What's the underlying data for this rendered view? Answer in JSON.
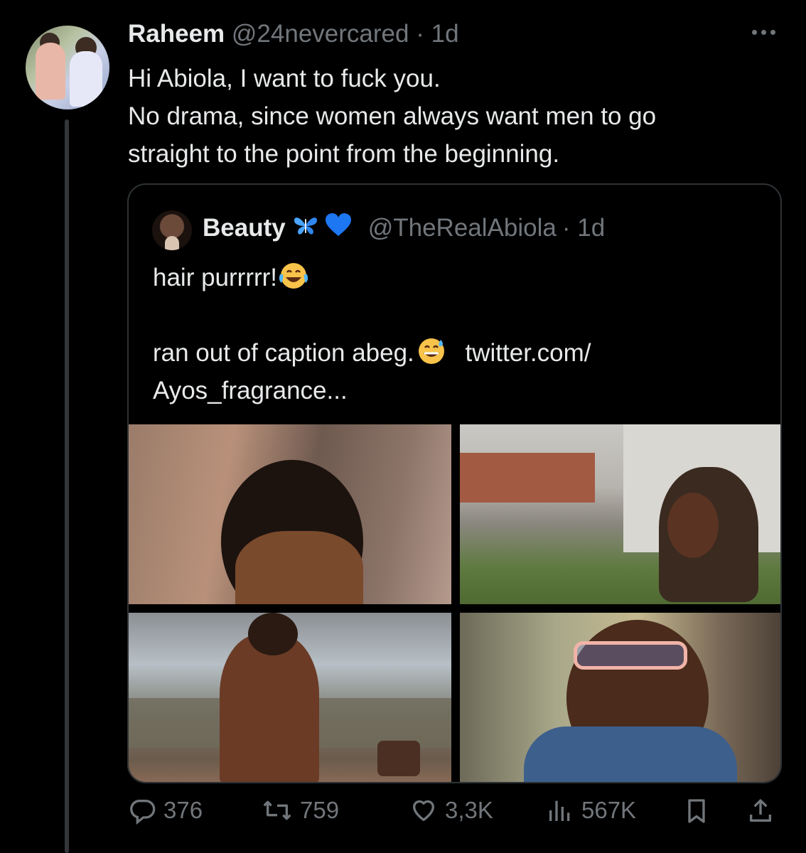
{
  "tweet": {
    "author_name": "Raheem",
    "author_handle": "@24nevercared",
    "timestamp": "· 1d",
    "text_lines": [
      "Hi Abiola, I want to fuck you.",
      "No drama, since women always want men to go",
      "straight to the point from the beginning."
    ]
  },
  "quote": {
    "author_name": "Beauty",
    "author_handle": "@TheRealAbiola",
    "timestamp": "· 1d",
    "line1": "hair purrrrr!",
    "line3": "ran out of caption abeg.",
    "line3_link": "twitter.com/",
    "line4": "Ayos_fragrance...",
    "photos": [
      "braided-hair-photo",
      "campus-selfie-photo",
      "fountain-photo",
      "smiling-glasses-photo"
    ]
  },
  "actions": {
    "replies": "376",
    "retweets": "759",
    "likes": "3,3K",
    "views": "567K"
  },
  "icons": {
    "reply": "reply-icon",
    "retweet": "retweet-icon",
    "like": "heart-icon",
    "views": "views-icon",
    "bookmark": "bookmark-icon",
    "share": "share-icon",
    "more": "more-icon"
  },
  "colors": {
    "background": "#000000",
    "text": "#e7e9ea",
    "secondary": "#71767b",
    "border": "#2f3336",
    "verified_blue": "#1d9bf0"
  }
}
